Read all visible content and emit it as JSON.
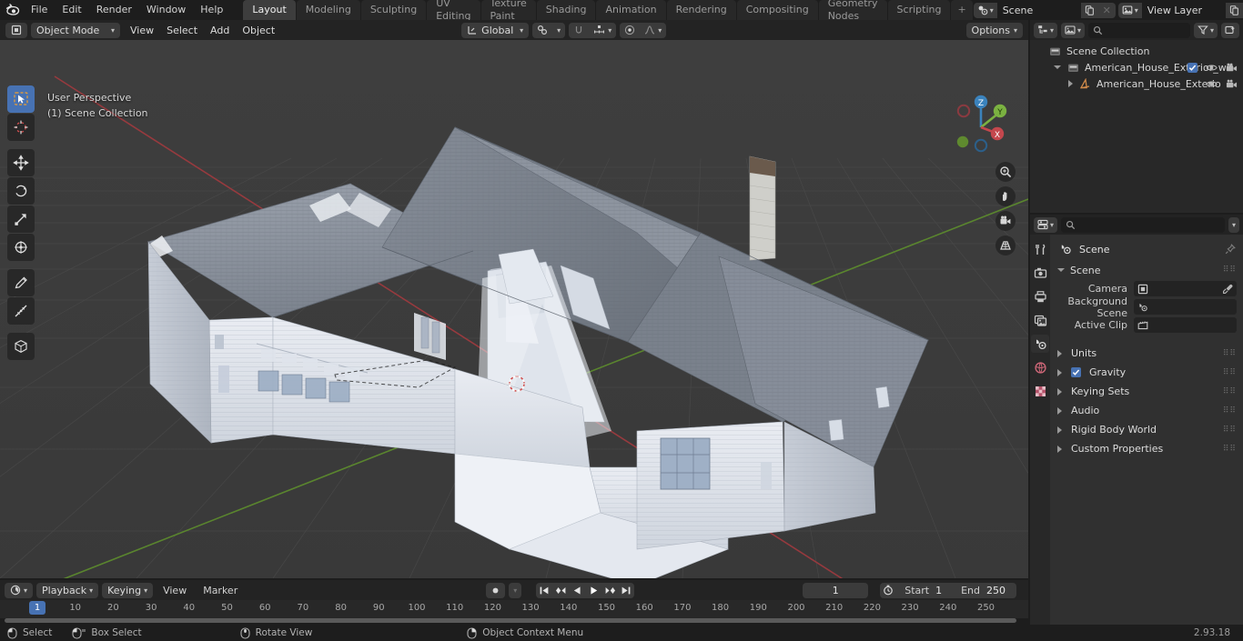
{
  "app": {
    "name": "Blender",
    "version": "2.93.18"
  },
  "topbar": {
    "menus": [
      "File",
      "Edit",
      "Render",
      "Window",
      "Help"
    ],
    "workspaces": [
      {
        "label": "Layout",
        "active": true
      },
      {
        "label": "Modeling",
        "active": false
      },
      {
        "label": "Sculpting",
        "active": false
      },
      {
        "label": "UV Editing",
        "active": false
      },
      {
        "label": "Texture Paint",
        "active": false
      },
      {
        "label": "Shading",
        "active": false
      },
      {
        "label": "Animation",
        "active": false
      },
      {
        "label": "Rendering",
        "active": false
      },
      {
        "label": "Compositing",
        "active": false
      },
      {
        "label": "Geometry Nodes",
        "active": false
      },
      {
        "label": "Scripting",
        "active": false
      }
    ],
    "add_workspace_label": "+",
    "scene_name": "Scene",
    "view_layer_name": "View Layer"
  },
  "viewport_header": {
    "mode": "Object Mode",
    "menus": [
      "View",
      "Select",
      "Add",
      "Object"
    ],
    "transform_orientation": "Global",
    "options_label": "Options"
  },
  "viewport": {
    "perspective_label": "User Perspective",
    "collection_label": "(1) Scene Collection",
    "gizmo_axes": [
      "Z",
      "Y",
      "X"
    ],
    "tools": [
      "tweak-select-tool",
      "cursor-tool",
      "move-tool",
      "rotate-tool",
      "scale-tool",
      "transform-tool",
      "annotate-tool",
      "measure-tool",
      "add-cube-tool"
    ],
    "nav_buttons": [
      "zoom-icon",
      "hand-icon",
      "camera-icon",
      "perspective-grid-icon"
    ]
  },
  "outliner": {
    "search_placeholder": "",
    "rows": [
      {
        "label": "Scene Collection",
        "indent": 0,
        "icon": "collection-icon",
        "expander": "none",
        "visibility": false
      },
      {
        "label": "American_House_Exterior_wit",
        "indent": 1,
        "icon": "collection-icon",
        "expander": "down",
        "visibility": true,
        "checkbox": true
      },
      {
        "label": "American_House_Exterio",
        "indent": 2,
        "icon": "mesh-data-icon",
        "expander": "right",
        "visibility": true,
        "checkbox": false
      }
    ]
  },
  "properties": {
    "search_placeholder": "",
    "tabs": [
      {
        "name": "tool-tab",
        "active": false
      },
      {
        "name": "render-tab",
        "active": false
      },
      {
        "name": "output-tab",
        "active": false
      },
      {
        "name": "view-layer-tab",
        "active": false
      },
      {
        "name": "scene-tab",
        "active": true
      },
      {
        "name": "world-tab",
        "active": false
      },
      {
        "name": "texture-tab",
        "active": false
      }
    ],
    "breadcrumb": "Scene",
    "panels": [
      {
        "label": "Scene",
        "expanded": true
      },
      {
        "label": "Units",
        "expanded": false
      },
      {
        "label": "Gravity",
        "expanded": false,
        "checkbox": true
      },
      {
        "label": "Keying Sets",
        "expanded": false
      },
      {
        "label": "Audio",
        "expanded": false
      },
      {
        "label": "Rigid Body World",
        "expanded": false
      },
      {
        "label": "Custom Properties",
        "expanded": false
      }
    ],
    "fields": [
      {
        "label": "Camera",
        "value": "",
        "icon": "camera-data-icon",
        "has_eyedropper": true
      },
      {
        "label": "Background Scene",
        "value": "",
        "icon": "scene-icon",
        "has_eyedropper": false
      },
      {
        "label": "Active Clip",
        "value": "",
        "icon": "clip-icon",
        "has_eyedropper": false
      }
    ]
  },
  "timeline": {
    "editor_type": "timeline-icon",
    "menus_dropdown": [
      "Playback",
      "Keying"
    ],
    "menus_flat": [
      "View",
      "Marker"
    ],
    "transport_buttons": [
      "jump-to-start",
      "jump-prev-keyframe",
      "play-reverse",
      "play",
      "jump-next-keyframe",
      "jump-to-end"
    ],
    "current_frame": "1",
    "start_label": "Start",
    "start_value": "1",
    "end_label": "End",
    "end_value": "250",
    "ruler_ticks": [
      "10",
      "20",
      "30",
      "40",
      "50",
      "60",
      "70",
      "80",
      "90",
      "100",
      "110",
      "120",
      "130",
      "140",
      "150",
      "160",
      "170",
      "180",
      "190",
      "200",
      "210",
      "220",
      "230",
      "240",
      "250"
    ],
    "playhead_frame": "1"
  },
  "statusbar": {
    "items": [
      {
        "icon": "mouse-left-icon",
        "label": "Select"
      },
      {
        "icon": "mouse-drag-icon",
        "label": "Box Select"
      },
      {
        "icon": "mouse-middle-icon",
        "label": "Rotate View"
      },
      {
        "icon": "mouse-right-icon",
        "label": "Object Context Menu"
      }
    ],
    "version": "2.93.18"
  },
  "colors": {
    "accent": "#4772b3",
    "panel_bg": "#303030",
    "header_bg": "#232323",
    "editor_bg": "#282828",
    "axis_x": "#c4474d",
    "axis_y": "#7bb241",
    "axis_z": "#3b83bd"
  }
}
